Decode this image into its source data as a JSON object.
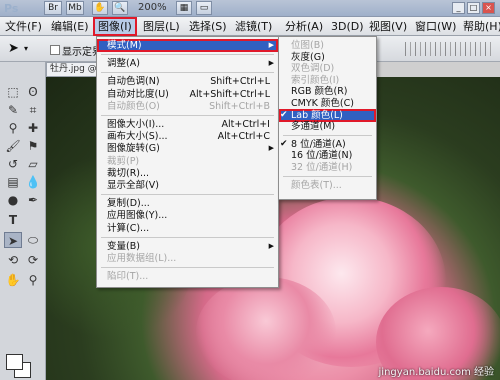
{
  "app": {
    "logo": "Ps"
  },
  "titlebar": {
    "btn_br": "Br",
    "btn_mb": "Mb",
    "zoom": "200%"
  },
  "menubar": [
    {
      "label": "文件(F)"
    },
    {
      "label": "编辑(E)"
    },
    {
      "label": "图像(I)"
    },
    {
      "label": "图层(L)"
    },
    {
      "label": "选择(S)"
    },
    {
      "label": "滤镜(T)"
    },
    {
      "label": "分析(A)"
    },
    {
      "label": "3D(D)"
    },
    {
      "label": "视图(V)"
    },
    {
      "label": "窗口(W)"
    },
    {
      "label": "帮助(H)"
    }
  ],
  "options": {
    "show_transform": "显示定界"
  },
  "document": {
    "tab": "牡丹.jpg @"
  },
  "image_menu": [
    {
      "label": "模式(M)",
      "submenu": true,
      "highlight": true
    },
    {
      "sep": true
    },
    {
      "label": "调整(A)",
      "submenu": true
    },
    {
      "sep": true
    },
    {
      "label": "自动色调(N)",
      "shortcut": "Shift+Ctrl+L"
    },
    {
      "label": "自动对比度(U)",
      "shortcut": "Alt+Shift+Ctrl+L"
    },
    {
      "label": "自动颜色(O)",
      "shortcut": "Shift+Ctrl+B",
      "disabled": true
    },
    {
      "sep": true
    },
    {
      "label": "图像大小(I)...",
      "shortcut": "Alt+Ctrl+I"
    },
    {
      "label": "画布大小(S)...",
      "shortcut": "Alt+Ctrl+C"
    },
    {
      "label": "图像旋转(G)",
      "submenu": true
    },
    {
      "label": "裁剪(P)",
      "disabled": true
    },
    {
      "label": "裁切(R)..."
    },
    {
      "label": "显示全部(V)"
    },
    {
      "sep": true
    },
    {
      "label": "复制(D)..."
    },
    {
      "label": "应用图像(Y)..."
    },
    {
      "label": "计算(C)..."
    },
    {
      "sep": true
    },
    {
      "label": "变量(B)",
      "submenu": true
    },
    {
      "label": "应用数据组(L)...",
      "disabled": true
    },
    {
      "sep": true
    },
    {
      "label": "陷印(T)...",
      "disabled": true
    }
  ],
  "mode_menu": [
    {
      "label": "位图(B)",
      "disabled": true
    },
    {
      "label": "灰度(G)"
    },
    {
      "label": "双色调(D)",
      "disabled": true
    },
    {
      "label": "索引颜色(I)",
      "disabled": true
    },
    {
      "label": "RGB 颜色(R)"
    },
    {
      "label": "CMYK 颜色(C)"
    },
    {
      "label": "Lab 颜色(L)",
      "checked": true,
      "selected": true
    },
    {
      "label": "多通道(M)"
    },
    {
      "sep": true
    },
    {
      "label": "8 位/通道(A)",
      "checked": true
    },
    {
      "label": "16 位/通道(N)"
    },
    {
      "label": "32 位/通道(H)",
      "disabled": true
    },
    {
      "sep": true
    },
    {
      "label": "颜色表(T)...",
      "disabled": true
    }
  ],
  "watermark": "jingyan.baidu.com 经验",
  "colors": {
    "highlight": "#3160c1",
    "annotation_red": "#e0192a"
  }
}
